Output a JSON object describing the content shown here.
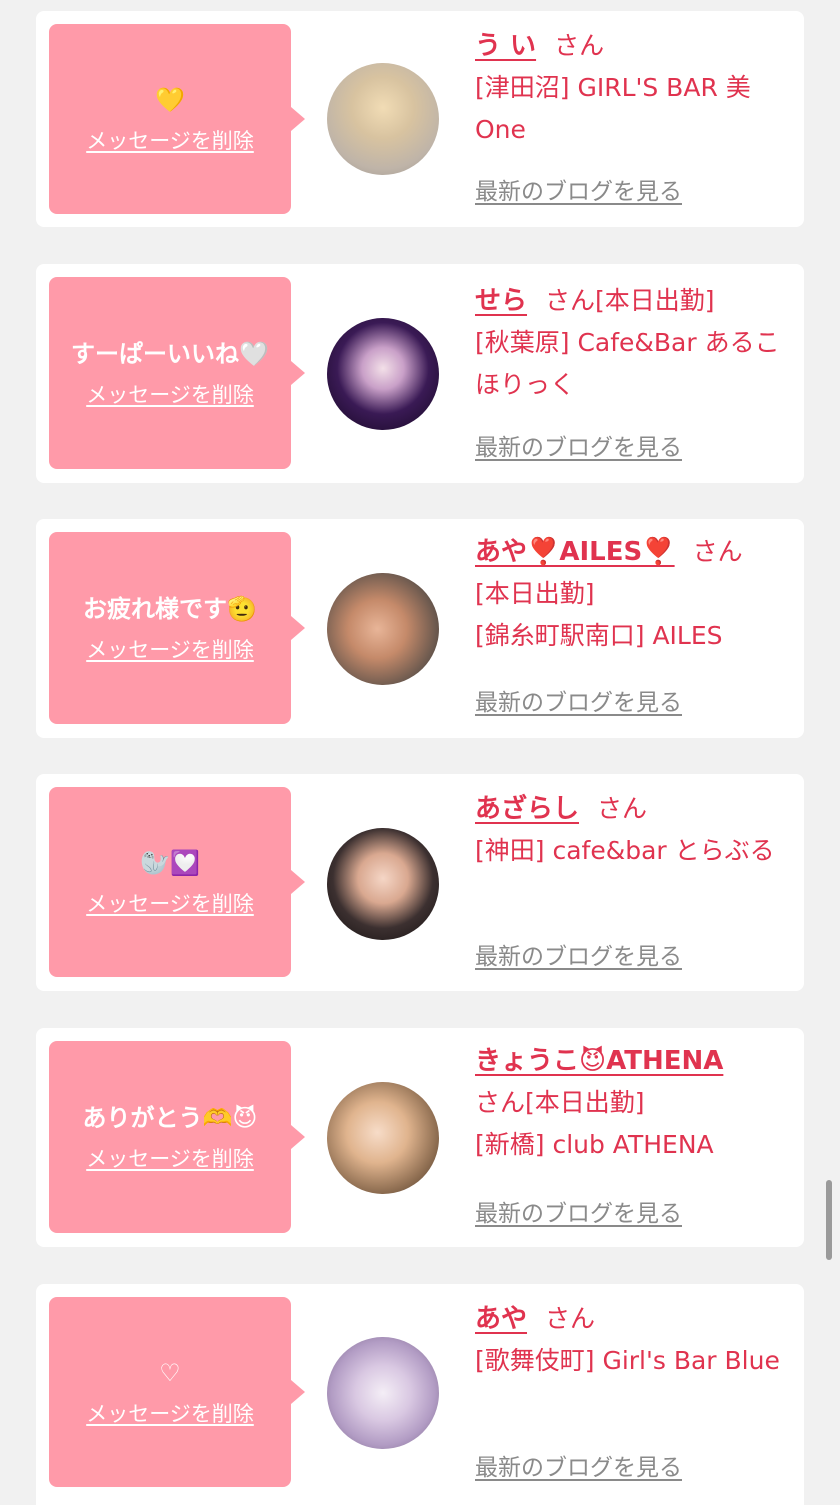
{
  "common": {
    "delete_label": "メッセージを削除",
    "blog_label": "最新のブログを見る",
    "san": "さん",
    "today": "[本日出勤]"
  },
  "cards": [
    {
      "message": "💛",
      "name": "う い",
      "today": "",
      "shop": "[津田沼] GIRL'S BAR 美One"
    },
    {
      "message": "すーぱーいいね🤍",
      "name": "せら",
      "today": "[本日出勤]",
      "shop": "[秋葉原] Cafe&Bar あるこほりっく"
    },
    {
      "message": "お疲れ様です🫡",
      "name": "あや❣️AILES❣️",
      "today": "[本日出勤]",
      "shop": "[錦糸町駅南口] AILES"
    },
    {
      "message": "🦭💟",
      "name": "あざらし",
      "today": "",
      "shop": "[神田] cafe&bar とらぶる"
    },
    {
      "message": "ありがとう🫶😈",
      "name": "きょうこ😈ATHENA",
      "today": "[本日出勤]",
      "shop": "[新橋] club ATHENA"
    },
    {
      "message": "♡",
      "name": "あや",
      "today": "",
      "shop": "[歌舞伎町] Girl's Bar Blue"
    }
  ],
  "colors": {
    "accent": "#e0334f",
    "bubble": "#ff9aa9",
    "background": "#f1f1f1",
    "link_gray": "#8a8a8a"
  }
}
